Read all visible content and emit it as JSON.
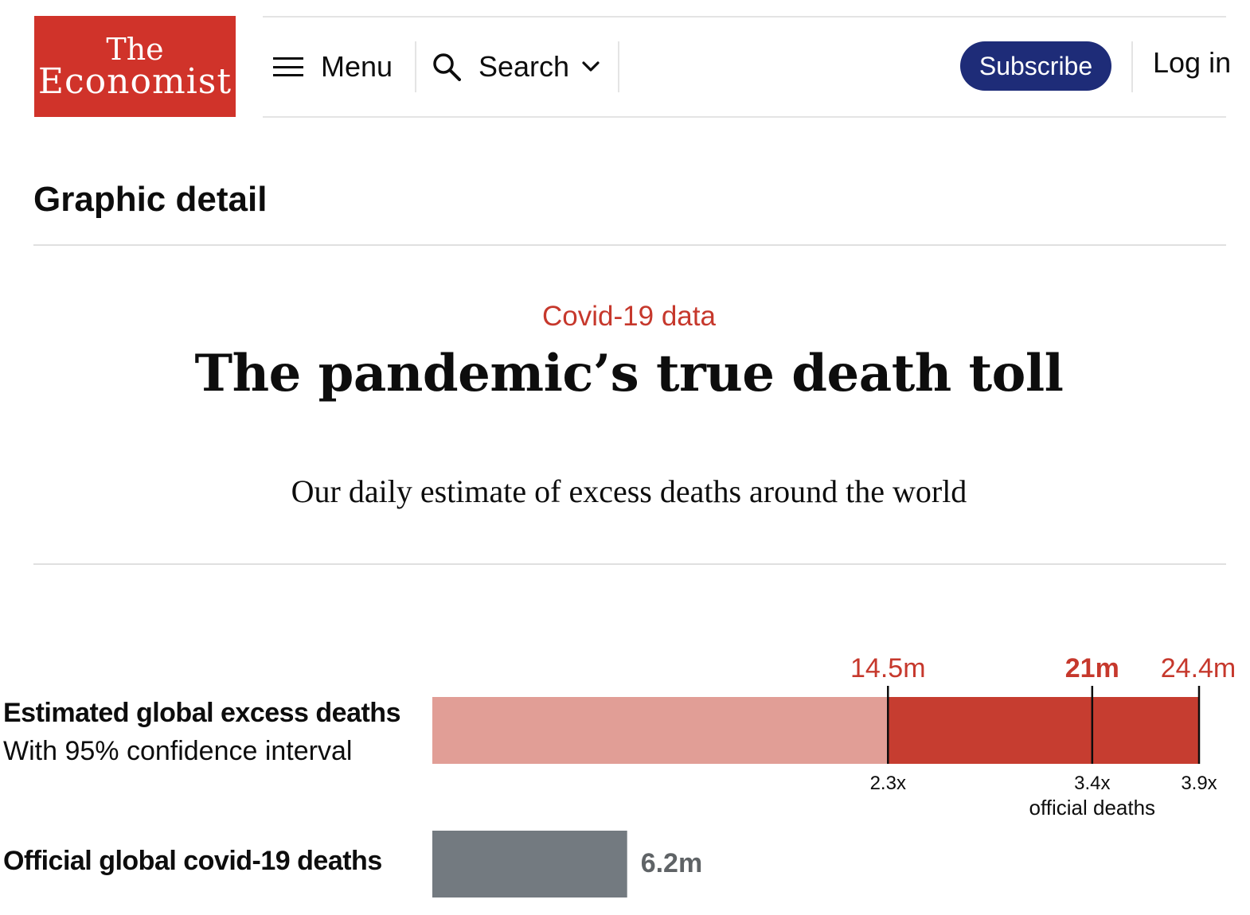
{
  "header": {
    "logo_line1": "The",
    "logo_line2": "Economist",
    "menu_label": "Menu",
    "search_label": "Search",
    "subscribe_label": "Subscribe",
    "login_label": "Log in"
  },
  "section": {
    "title": "Graphic detail"
  },
  "article": {
    "rubric": "Covid-19 data",
    "headline": "The pandemic’s true death toll",
    "subheadline": "Our daily estimate of excess deaths around the world"
  },
  "colors": {
    "logo_red": "#d0332a",
    "subscribe_navy": "#1e2c78",
    "accent_red": "#c6382c",
    "ci_light": "#e19e96",
    "ci_dark": "#c63d30",
    "official_grey": "#737a80"
  },
  "chart_labels": {
    "estimated_title": "Estimated global excess deaths",
    "estimated_subtitle": "With 95% confidence interval",
    "official_title": "Official global covid-19 deaths",
    "official_deaths_caption": "official deaths"
  },
  "chart_data": {
    "type": "bar",
    "units": "millions of deaths",
    "xlim": [
      0,
      24.4
    ],
    "grid": false,
    "estimated": {
      "lower": 14.5,
      "central": 21,
      "upper": 24.4,
      "lower_label": "14.5m",
      "central_label": "21m",
      "upper_label": "24.4m",
      "lower_multiple": "2.3x",
      "central_multiple": "3.4x",
      "upper_multiple": "3.9x"
    },
    "official": {
      "value": 6.2,
      "label": "6.2m"
    }
  }
}
